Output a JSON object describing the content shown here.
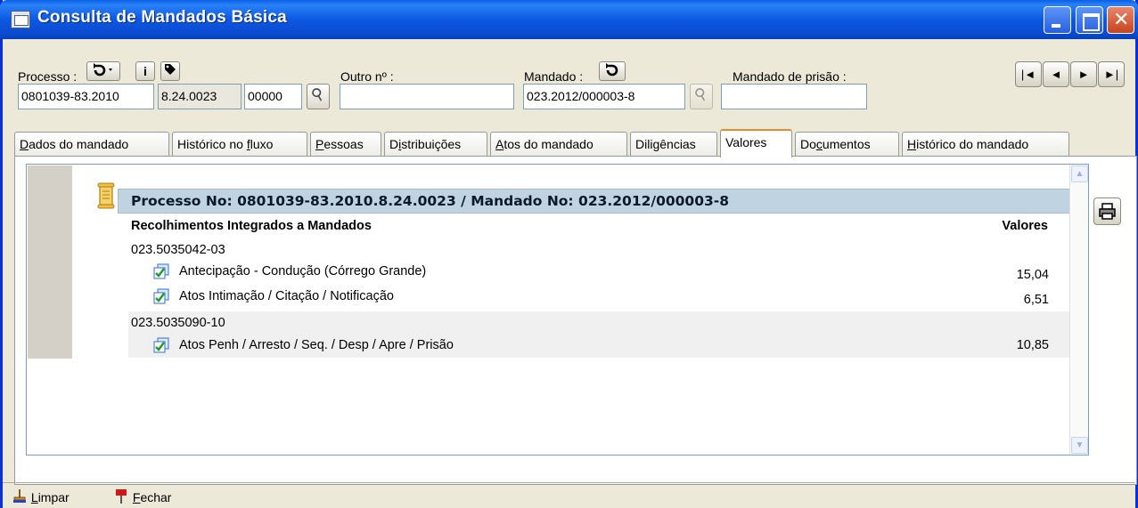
{
  "window": {
    "title": "Consulta de Mandados Básica"
  },
  "form": {
    "processo_label": "Processo :",
    "processo_part1": "0801039-83.2010",
    "processo_part2": "8.24.0023",
    "processo_part3": "00000",
    "outro_label": "Outro nº :",
    "outro_value": "",
    "mandado_label": "Mandado :",
    "mandado_value": "023.2012/000003-8",
    "mandado_prisao_label": "Mandado de prisão :",
    "mandado_prisao_value": "",
    "info_btn": "i"
  },
  "nav": {
    "first": "|◄",
    "prev": "◄",
    "next": "►",
    "last": "►|"
  },
  "tabs": [
    {
      "pre": "",
      "u": "D",
      "post": "ados do mandado"
    },
    {
      "pre": "Histórico no ",
      "u": "f",
      "post": "luxo"
    },
    {
      "pre": "",
      "u": "P",
      "post": "essoas"
    },
    {
      "pre": "D",
      "u": "i",
      "post": "stribuições"
    },
    {
      "pre": "",
      "u": "A",
      "post": "tos do mandado"
    },
    {
      "pre": "Dili",
      "u": "g",
      "post": "ências"
    },
    {
      "pre": "Valores",
      "u": "",
      "post": ""
    },
    {
      "pre": "Do",
      "u": "c",
      "post": "umentos"
    },
    {
      "pre": "",
      "u": "H",
      "post": "istórico do mandado"
    }
  ],
  "valores": {
    "header": "Processo No: 0801039-83.2010.8.24.0023 / Mandado No: 023.2012/000003-8",
    "col_title": "Recolhimentos Integrados a Mandados",
    "col_values": "Valores",
    "groups": [
      {
        "code": "023.5035042-03",
        "items": [
          {
            "label": "Antecipação - Condução (Córrego Grande)",
            "value": "15,04"
          },
          {
            "label": "Atos Intimação / Citação / Notificação",
            "value": "6,51"
          }
        ]
      },
      {
        "code": "023.5035090-10",
        "items": [
          {
            "label": "Atos Penh / Arresto / Seq. / Desp / Apre / Prisão",
            "value": "10,85"
          }
        ]
      }
    ]
  },
  "footer": {
    "limpar_u": "L",
    "limpar_rest": "impar",
    "fechar_u": "F",
    "fechar_rest": "echar"
  }
}
